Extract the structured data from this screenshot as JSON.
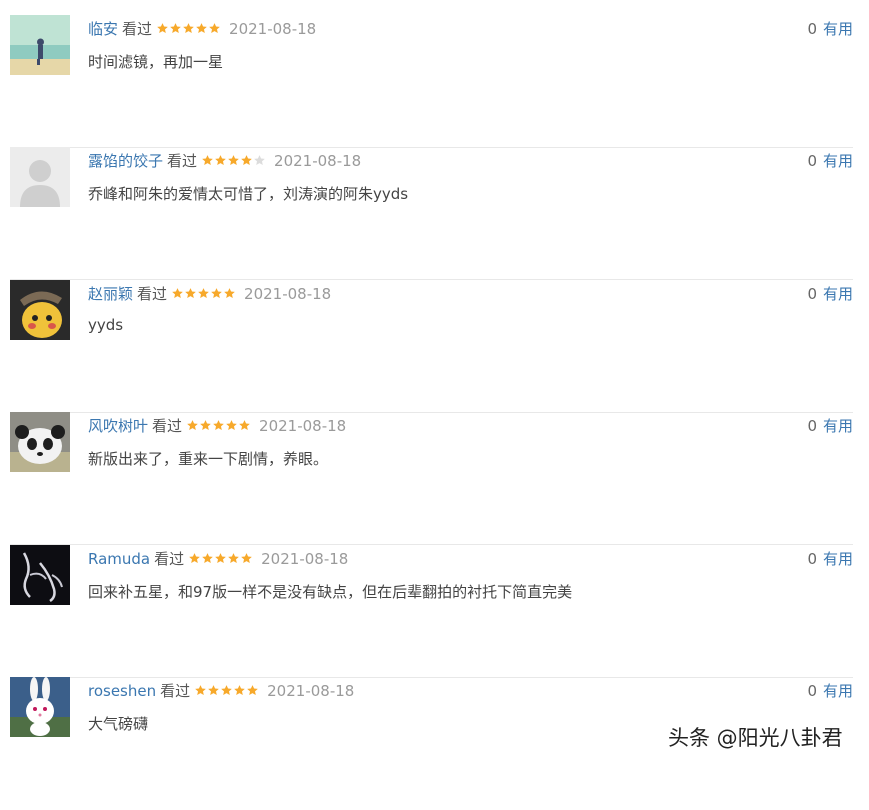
{
  "colors": {
    "link": "#3b77b0",
    "star": "#f7a92b",
    "star_empty": "#dcdcdc",
    "date": "#9a9a9a"
  },
  "reviews": [
    {
      "user": "临安",
      "status": "看过",
      "rating": 5,
      "date": "2021-08-18",
      "comment": "时间滤镜，再加一星",
      "count": "0",
      "useful": "有用",
      "avatar": "beach-figure-avatar"
    },
    {
      "user": "露馅的饺子",
      "status": "看过",
      "rating": 4,
      "date": "2021-08-18",
      "comment": "乔峰和阿朱的爱情太可惜了，刘涛演的阿朱yyds",
      "count": "0",
      "useful": "有用",
      "avatar": "default-person-avatar"
    },
    {
      "user": "赵丽颖",
      "status": "看过",
      "rating": 5,
      "date": "2021-08-18",
      "comment": "yyds",
      "count": "0",
      "useful": "有用",
      "avatar": "pikachu-detective-avatar"
    },
    {
      "user": "风吹树叶",
      "status": "看过",
      "rating": 5,
      "date": "2021-08-18",
      "comment": "新版出来了，重来一下剧情，养眼。",
      "count": "0",
      "useful": "有用",
      "avatar": "panda-avatar"
    },
    {
      "user": "Ramuda",
      "status": "看过",
      "rating": 5,
      "date": "2021-08-18",
      "comment": "回来补五星，和97版一样不是没有缺点，但在后辈翻拍的衬托下简直完美",
      "count": "0",
      "useful": "有用",
      "avatar": "hands-avatar"
    },
    {
      "user": "roseshen",
      "status": "看过",
      "rating": 5,
      "date": "2021-08-18",
      "comment": "大气磅礴",
      "count": "0",
      "useful": "有用",
      "avatar": "bunny-avatar"
    }
  ],
  "watermark": "头条 @阳光八卦君"
}
